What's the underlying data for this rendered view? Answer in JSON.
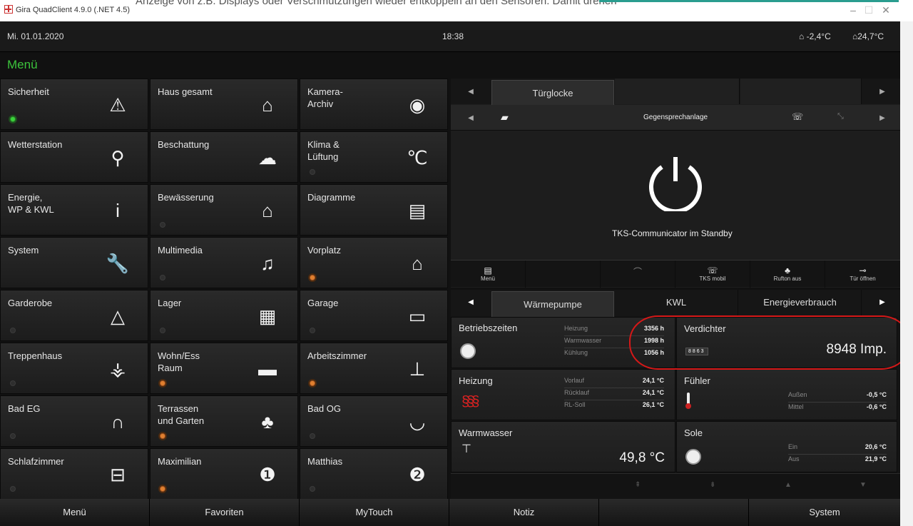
{
  "window": {
    "title": "Gira QuadClient 4.9.0 (.NET 4.5)",
    "bg_text": "Anzeige von z.B. Displays oder Verschmutzungen wieder entkoppeln an den Sensoren. Damit drehen"
  },
  "header": {
    "date": "Mi. 01.01.2020",
    "time": "18:38",
    "outdoor_temp": "-2,4°C",
    "indoor_temp": "24,7°C"
  },
  "menu_title": "Menü",
  "tiles": [
    {
      "label": "Sicherheit",
      "icon": "alarm-icon",
      "dot": "green"
    },
    {
      "label": "Haus gesamt",
      "icon": "house-icon",
      "dot": "none"
    },
    {
      "label": "Kamera-\nArchiv",
      "icon": "camera-folder-icon",
      "dot": "none"
    },
    {
      "label": "Wetterstation",
      "icon": "anemometer-icon",
      "dot": "none"
    },
    {
      "label": "Beschattung",
      "icon": "sun-cloud-icon",
      "dot": "none"
    },
    {
      "label": "Klima &\nLüftung",
      "icon": "thermometer-icon",
      "dot": "grey"
    },
    {
      "label": "Energie,\nWP & KWL",
      "icon": "info-icon",
      "dot": "none"
    },
    {
      "label": "Bewässerung",
      "icon": "watering-can-icon",
      "dot": "grey"
    },
    {
      "label": "Diagramme",
      "icon": "chart-icon",
      "dot": "none"
    },
    {
      "label": "System",
      "icon": "wrench-icon",
      "dot": "none"
    },
    {
      "label": "Multimedia",
      "icon": "music-screen-icon",
      "dot": "grey"
    },
    {
      "label": "Vorplatz",
      "icon": "carport-icon",
      "dot": "orange"
    },
    {
      "label": "Garderobe",
      "icon": "hanger-icon",
      "dot": "grey"
    },
    {
      "label": "Lager",
      "icon": "shelf-icon",
      "dot": "grey"
    },
    {
      "label": "Garage",
      "icon": "garage-icon",
      "dot": "grey"
    },
    {
      "label": "Treppenhaus",
      "icon": "stairs-icon",
      "dot": "grey"
    },
    {
      "label": "Wohn/Ess\nRaum",
      "icon": "sofa-icon",
      "dot": "orange"
    },
    {
      "label": "Arbeitszimmer",
      "icon": "office-chair-icon",
      "dot": "orange"
    },
    {
      "label": "Bad EG",
      "icon": "shower-icon",
      "dot": "grey"
    },
    {
      "label": "Terrassen\nund Garten",
      "icon": "tree-house-icon",
      "dot": "orange"
    },
    {
      "label": "Bad OG",
      "icon": "bathtub-icon",
      "dot": "grey"
    },
    {
      "label": "Schlafzimmer",
      "icon": "bed-icon",
      "dot": "grey"
    },
    {
      "label": "Maximilian",
      "icon": "teddy-1-icon",
      "dot": "orange"
    },
    {
      "label": "Matthias",
      "icon": "teddy-2-icon",
      "dot": "grey"
    }
  ],
  "door": {
    "tab": "Türglocke",
    "subtitle": "Gegensprechanlage",
    "status": "TKS-Communicator im Standby",
    "buttons": [
      {
        "label": "Menü"
      },
      {
        "label": ""
      },
      {
        "label": ""
      },
      {
        "label": "TKS mobil"
      },
      {
        "label": "Rufton aus"
      },
      {
        "label": "Tür öffnen"
      }
    ]
  },
  "heat": {
    "tabs": [
      "Wärmepumpe",
      "KWL",
      "Energieverbrauch"
    ],
    "betrieb": {
      "title": "Betriebszeiten",
      "rows": [
        {
          "k": "Heizung",
          "v": "3356 h"
        },
        {
          "k": "Warmwasser",
          "v": "1998 h"
        },
        {
          "k": "Kühlung",
          "v": "1056 h"
        }
      ]
    },
    "verdichter": {
      "title": "Verdichter",
      "counter": "8863",
      "value": "8948 Imp."
    },
    "heizung": {
      "title": "Heizung",
      "rows": [
        {
          "k": "Vorlauf",
          "v": "24,1 °C"
        },
        {
          "k": "Rücklauf",
          "v": "24,1 °C"
        },
        {
          "k": "RL-Soll",
          "v": "26,1 °C"
        }
      ]
    },
    "fuehler": {
      "title": "Fühler",
      "rows": [
        {
          "k": "Außen",
          "v": "-0,5 °C"
        },
        {
          "k": "Mittel",
          "v": "-0,6 °C"
        }
      ]
    },
    "warmwasser": {
      "title": "Warmwasser",
      "value": "49,8 °C"
    },
    "sole": {
      "title": "Sole",
      "rows": [
        {
          "k": "Ein",
          "v": "20,6 °C"
        },
        {
          "k": "Aus",
          "v": "21,9 °C"
        }
      ]
    }
  },
  "bottom": [
    "Menü",
    "Favoriten",
    "MyTouch",
    "Notiz",
    "",
    "System"
  ]
}
